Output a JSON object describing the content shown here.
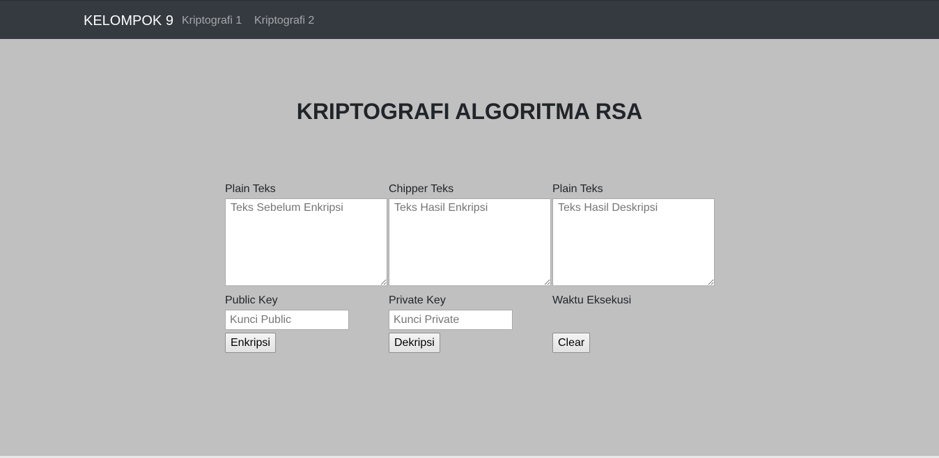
{
  "navbar": {
    "brand": "KELOMPOK 9",
    "links": [
      {
        "label": "Kriptografi 1"
      },
      {
        "label": "Kriptografi 2"
      }
    ]
  },
  "page": {
    "title": "KRIPTOGRAFI ALGORITMA RSA"
  },
  "columns": [
    {
      "top_label": "Plain Teks",
      "textarea_placeholder": "Teks Sebelum Enkripsi",
      "textarea_value": "",
      "bottom_label": "Public Key",
      "input_placeholder": "Kunci Public",
      "input_value": "",
      "button_label": "Enkripsi"
    },
    {
      "top_label": "Chipper Teks",
      "textarea_placeholder": "Teks Hasil Enkripsi",
      "textarea_value": "",
      "bottom_label": "Private Key",
      "input_placeholder": "Kunci Private",
      "input_value": "",
      "button_label": "Dekripsi"
    },
    {
      "top_label": "Plain Teks",
      "textarea_placeholder": "Teks Hasil Deskripsi",
      "textarea_value": "",
      "bottom_label": "Waktu Eksekusi",
      "button_label": "Clear"
    }
  ]
}
